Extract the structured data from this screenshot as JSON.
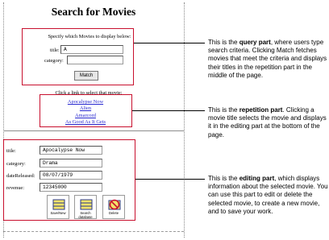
{
  "page": {
    "title": "Search for Movies",
    "query": {
      "prompt": "Specify which Movies to display below:",
      "title_label": "title:",
      "title_value": "A",
      "category_label": "category:",
      "category_value": "",
      "match_button": "Match"
    },
    "repetition": {
      "prompt": "Click a link to select that movie:",
      "links": [
        "Apocalypse Now",
        "Alien",
        "Amarcord",
        "As Good As It Gets"
      ]
    },
    "editing": {
      "title_label": "title:",
      "title_value": "Apocalypse Now",
      "category_label": "category:",
      "category_value": "Drama",
      "date_label": "dateReleased:",
      "date_value": "08/07/1979",
      "revenue_label": "revenue:",
      "revenue_value": "12345000",
      "buttons": [
        {
          "label": "Save/New",
          "icon": "save-icon"
        },
        {
          "label": "Search database",
          "icon": "search-database-icon"
        },
        {
          "label": "Delete",
          "icon": "delete-icon"
        }
      ]
    }
  },
  "annotations": {
    "query": {
      "before": "This is the ",
      "bold": "query part",
      "after": ", where users type search criteria. Clicking Match fetches movies that meet the criteria and displays their titles in the repetition part in the middle of the page."
    },
    "repetition": {
      "before": "This is the ",
      "bold": "repetition part",
      "after": ". Clicking a movie title selects the movie and displays it in the editing part at the bottom of the page."
    },
    "editing": {
      "before": "This is the ",
      "bold": "editing part",
      "after": ", which displays information about the selected movie. You can use this part to edit or delete the selected movie, to create a new movie, and to save your work."
    }
  },
  "colors": {
    "highlight": "#c8102e",
    "link": "#2a2ad0"
  }
}
